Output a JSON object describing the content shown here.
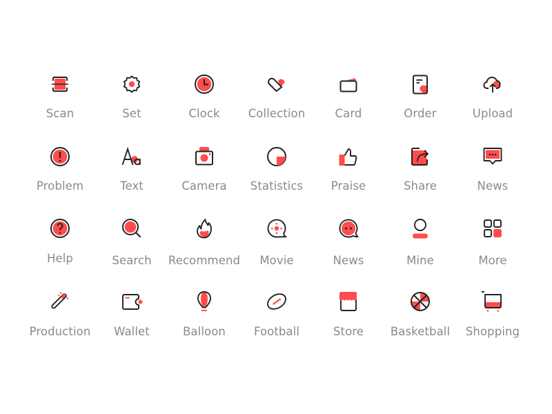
{
  "colors": {
    "accent": "#ff4c4c",
    "stroke": "#222222",
    "label": "#8a8a8a",
    "background": "#ffffff"
  },
  "icons": [
    {
      "label": "Scan",
      "icon": "scan-icon"
    },
    {
      "label": "Set",
      "icon": "settings-icon"
    },
    {
      "label": "Clock",
      "icon": "clock-icon"
    },
    {
      "label": "Collection",
      "icon": "heart-icon"
    },
    {
      "label": "Card",
      "icon": "card-icon"
    },
    {
      "label": "Order",
      "icon": "order-icon"
    },
    {
      "label": "Upload",
      "icon": "cloud-upload-icon"
    },
    {
      "label": "Problem",
      "icon": "exclamation-icon"
    },
    {
      "label": "Text",
      "icon": "text-icon"
    },
    {
      "label": "Camera",
      "icon": "camera-icon"
    },
    {
      "label": "Statistics",
      "icon": "statistics-icon"
    },
    {
      "label": "Praise",
      "icon": "thumbs-up-icon"
    },
    {
      "label": "Share",
      "icon": "share-icon"
    },
    {
      "label": "News",
      "icon": "message-icon"
    },
    {
      "label": "Help",
      "icon": "question-icon"
    },
    {
      "label": "Search",
      "icon": "search-icon"
    },
    {
      "label": "Recommend",
      "icon": "fire-icon"
    },
    {
      "label": "Movie",
      "icon": "film-reel-icon"
    },
    {
      "label": "News",
      "icon": "chat-bubble-icon"
    },
    {
      "label": "Mine",
      "icon": "user-icon"
    },
    {
      "label": "More",
      "icon": "grid-icon"
    },
    {
      "label": "Production",
      "icon": "magic-wand-icon"
    },
    {
      "label": "Wallet",
      "icon": "wallet-icon"
    },
    {
      "label": "Balloon",
      "icon": "balloon-icon"
    },
    {
      "label": "Football",
      "icon": "football-icon"
    },
    {
      "label": "Store",
      "icon": "store-icon"
    },
    {
      "label": "Basketball",
      "icon": "basketball-icon"
    },
    {
      "label": "Shopping",
      "icon": "shopping-cart-icon"
    }
  ]
}
